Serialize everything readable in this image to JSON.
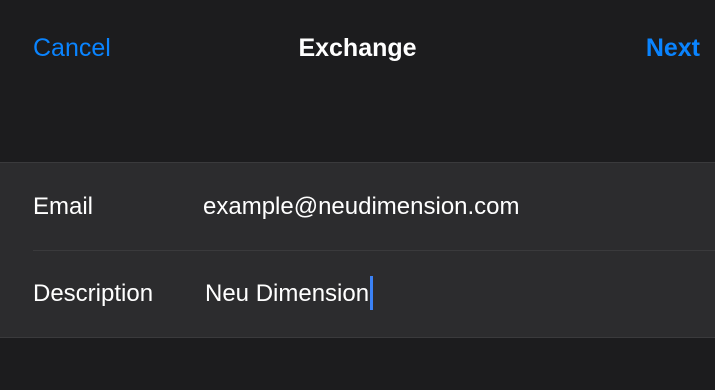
{
  "nav": {
    "cancel_label": "Cancel",
    "title": "Exchange",
    "next_label": "Next"
  },
  "form": {
    "email": {
      "label": "Email",
      "value": "example@neudimension.com"
    },
    "description": {
      "label": "Description",
      "value": "Neu Dimension"
    }
  },
  "colors": {
    "accent": "#0a84ff",
    "background": "#1c1c1e",
    "group_background": "#2c2c2e",
    "caret": "#3b82f6"
  }
}
